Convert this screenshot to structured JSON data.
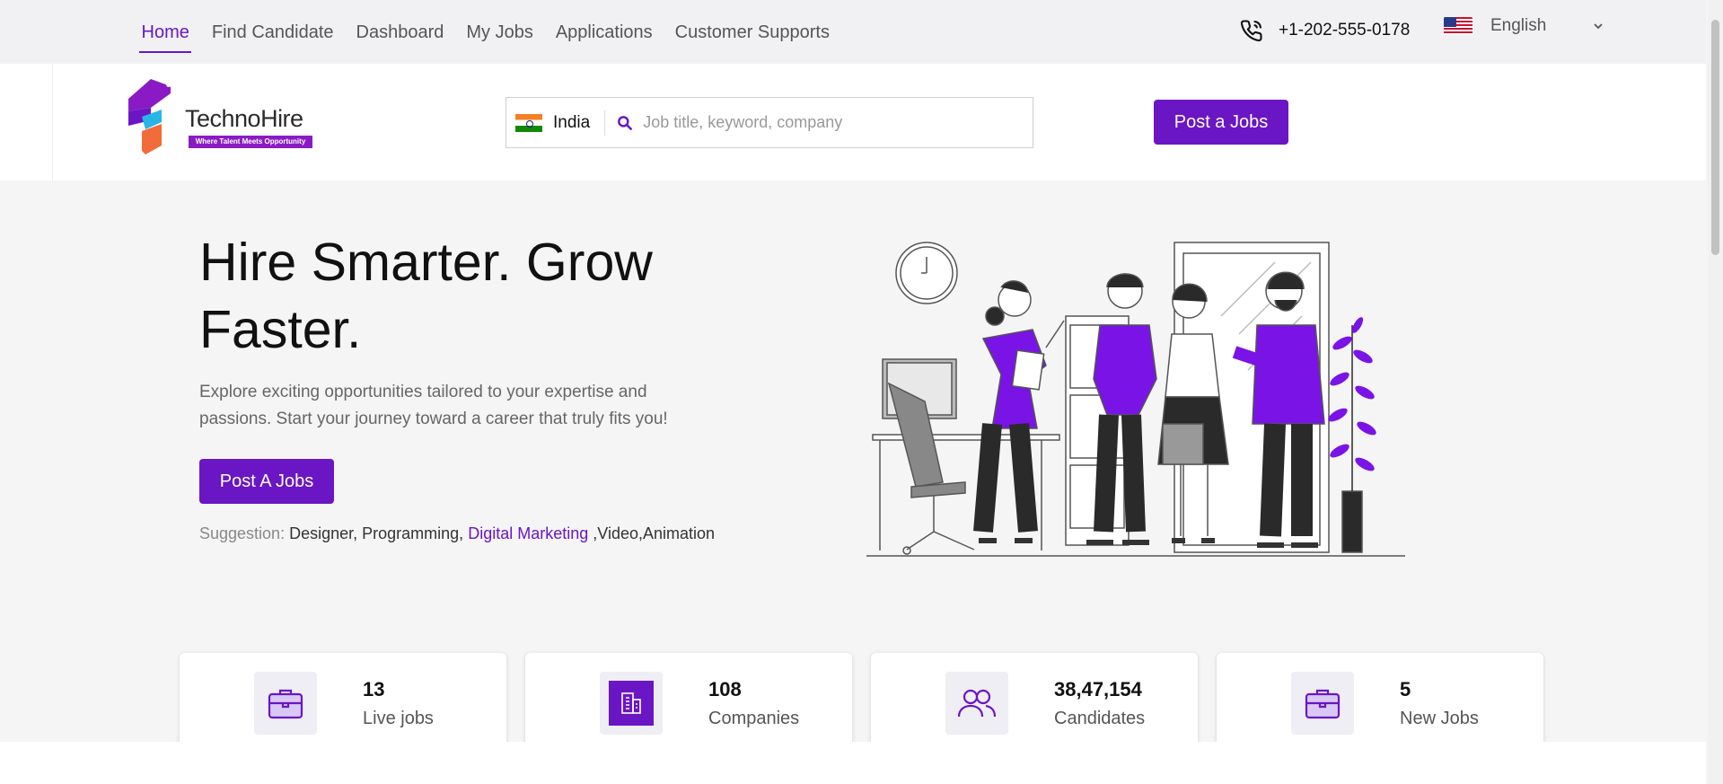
{
  "topnav": {
    "items": [
      "Home",
      "Find Candidate",
      "Dashboard",
      "My Jobs",
      "Applications",
      "Customer Supports"
    ],
    "phone": "+1-202-555-0178",
    "language": "English"
  },
  "header": {
    "logo_title": "TechnoHire",
    "logo_tagline": "Where Talent Meets Opportunity",
    "search": {
      "country": "India",
      "placeholder": "Job title, keyword, company"
    },
    "post_button": "Post a Jobs"
  },
  "hero": {
    "title": "Hire Smarter. Grow Faster.",
    "description": "Explore exciting opportunities tailored to your expertise and passions. Start your journey toward a career that truly fits you!",
    "cta": "Post A Jobs",
    "suggestion_label": "Suggestion:",
    "suggestion_part1": "Designer, Programming,",
    "suggestion_highlight": "Digital Marketing",
    "suggestion_part2": ",Video,Animation"
  },
  "stats": [
    {
      "value": "13",
      "label": "Live jobs",
      "icon": "briefcase-icon"
    },
    {
      "value": "108",
      "label": "Companies",
      "icon": "building-icon"
    },
    {
      "value": "38,47,154",
      "label": "Candidates",
      "icon": "users-icon"
    },
    {
      "value": "5",
      "label": "New Jobs",
      "icon": "briefcase-icon"
    }
  ],
  "colors": {
    "brand": "#6a16c4",
    "accent_orange": "#f26b3a",
    "accent_cyan": "#29b6e6"
  }
}
